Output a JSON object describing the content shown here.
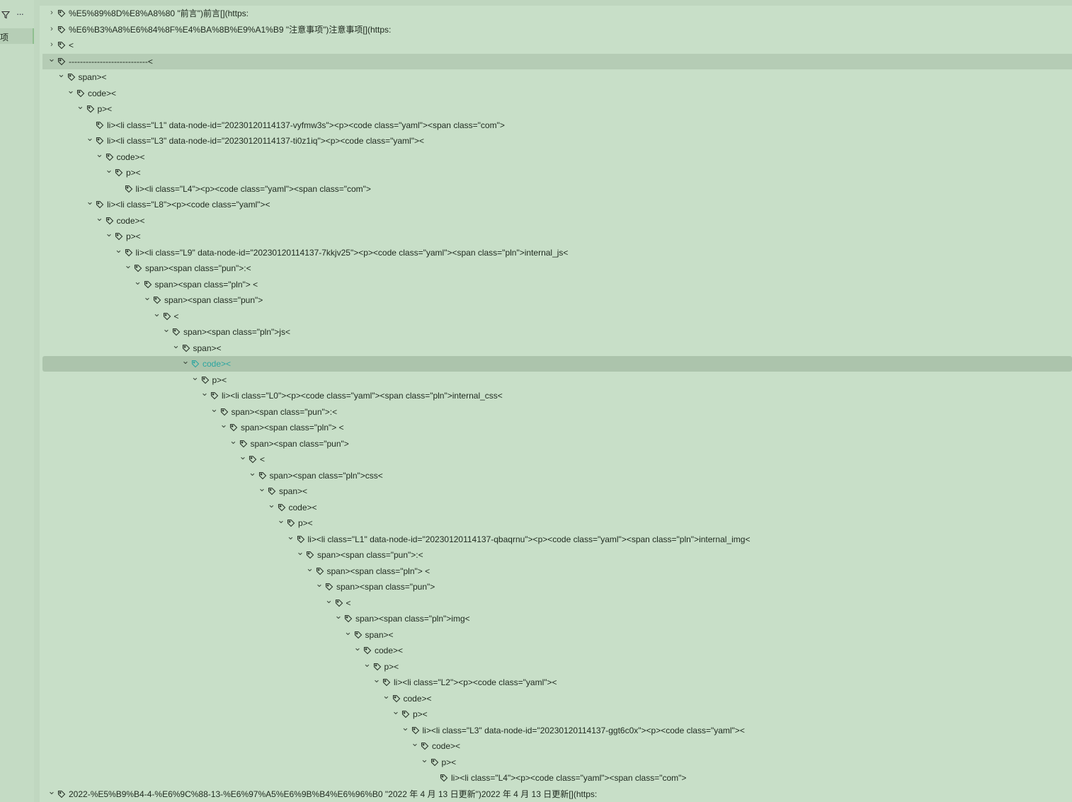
{
  "sidebar": {
    "item_label": "项"
  },
  "rows": [
    {
      "d": 0,
      "c": ">",
      "t": "%E5%89%8D%E8%A8%80 \"前言\")前言[](https:"
    },
    {
      "d": 0,
      "c": ">",
      "t": "%E6%B3%A8%E6%84%8F%E4%BA%8B%E9%A1%B9 \"注意事项\")注意事项[](https:"
    },
    {
      "d": 0,
      "c": ">",
      "t": "<"
    },
    {
      "d": 0,
      "c": "v",
      "t": "----------------------------<",
      "sel": true
    },
    {
      "d": 1,
      "c": "v",
      "t": "span><"
    },
    {
      "d": 2,
      "c": "v",
      "t": "code><"
    },
    {
      "d": 3,
      "c": "v",
      "t": "p><"
    },
    {
      "d": 4,
      "c": "",
      "t": "li><li class=\"L1\" data-node-id=\"20230120114137-vyfmw3s\"><p><code class=\"yaml\"><span class=\"com\">"
    },
    {
      "d": 4,
      "c": "v",
      "t": "li><li class=\"L3\" data-node-id=\"20230120114137-ti0z1iq\"><p><code class=\"yaml\"><"
    },
    {
      "d": 5,
      "c": "v",
      "t": "code><"
    },
    {
      "d": 6,
      "c": "v",
      "t": "p><"
    },
    {
      "d": 7,
      "c": "",
      "t": "li><li class=\"L4\"><p><code class=\"yaml\"><span class=\"com\">"
    },
    {
      "d": 4,
      "c": "v",
      "t": "li><li class=\"L8\"><p><code class=\"yaml\"><"
    },
    {
      "d": 5,
      "c": "v",
      "t": "code><"
    },
    {
      "d": 6,
      "c": "v",
      "t": "p><"
    },
    {
      "d": 7,
      "c": "v",
      "t": "li><li class=\"L9\" data-node-id=\"20230120114137-7kkjv25\"><p><code class=\"yaml\"><span class=\"pln\">internal_js<"
    },
    {
      "d": 8,
      "c": "v",
      "t": "span><span class=\"pun\">:<"
    },
    {
      "d": 9,
      "c": "v",
      "t": "span><span class=\"pln\"> <"
    },
    {
      "d": 10,
      "c": "v",
      "t": "span><span class=\"pun\">"
    },
    {
      "d": 11,
      "c": "v",
      "t": "<"
    },
    {
      "d": 12,
      "c": "v",
      "t": "span><span class=\"pln\">js<"
    },
    {
      "d": 13,
      "c": "v",
      "t": "span><"
    },
    {
      "d": 14,
      "c": "v",
      "t": "code><",
      "active": true
    },
    {
      "d": 15,
      "c": "v",
      "t": "p><"
    },
    {
      "d": 16,
      "c": "v",
      "t": "li><li class=\"L0\"><p><code class=\"yaml\"><span class=\"pln\">internal_css<"
    },
    {
      "d": 17,
      "c": "v",
      "t": "span><span class=\"pun\">:<"
    },
    {
      "d": 18,
      "c": "v",
      "t": "span><span class=\"pln\"> <"
    },
    {
      "d": 19,
      "c": "v",
      "t": "span><span class=\"pun\">"
    },
    {
      "d": 20,
      "c": "v",
      "t": "<"
    },
    {
      "d": 21,
      "c": "v",
      "t": "span><span class=\"pln\">css<"
    },
    {
      "d": 22,
      "c": "v",
      "t": "span><"
    },
    {
      "d": 23,
      "c": "v",
      "t": "code><"
    },
    {
      "d": 24,
      "c": "v",
      "t": "p><"
    },
    {
      "d": 25,
      "c": "v",
      "t": "li><li class=\"L1\" data-node-id=\"20230120114137-qbaqrnu\"><p><code class=\"yaml\"><span class=\"pln\">internal_img<"
    },
    {
      "d": 26,
      "c": "v",
      "t": "span><span class=\"pun\">:<"
    },
    {
      "d": 27,
      "c": "v",
      "t": "span><span class=\"pln\"> <"
    },
    {
      "d": 28,
      "c": "v",
      "t": "span><span class=\"pun\">"
    },
    {
      "d": 29,
      "c": "v",
      "t": "<"
    },
    {
      "d": 30,
      "c": "v",
      "t": "span><span class=\"pln\">img<"
    },
    {
      "d": 31,
      "c": "v",
      "t": "span><"
    },
    {
      "d": 32,
      "c": "v",
      "t": "code><"
    },
    {
      "d": 33,
      "c": "v",
      "t": "p><"
    },
    {
      "d": 34,
      "c": "v",
      "t": "li><li class=\"L2\"><p><code class=\"yaml\"><"
    },
    {
      "d": 35,
      "c": "v",
      "t": "code><"
    },
    {
      "d": 36,
      "c": "v",
      "t": "p><"
    },
    {
      "d": 37,
      "c": "v",
      "t": "li><li class=\"L3\" data-node-id=\"20230120114137-ggt6c0x\"><p><code class=\"yaml\"><"
    },
    {
      "d": 38,
      "c": "v",
      "t": "code><"
    },
    {
      "d": 39,
      "c": "v",
      "t": "p><"
    },
    {
      "d": 40,
      "c": "",
      "t": "li><li class=\"L4\"><p><code class=\"yaml\"><span class=\"com\">"
    },
    {
      "d": 0,
      "c": "v",
      "t": "2022-%E5%B9%B4-4-%E6%9C%88-13-%E6%97%A5%E6%9B%B4%E6%96%B0 \"2022 年 4 月 13 日更新\")2022 年 4 月 13 日更新[](https:"
    }
  ]
}
